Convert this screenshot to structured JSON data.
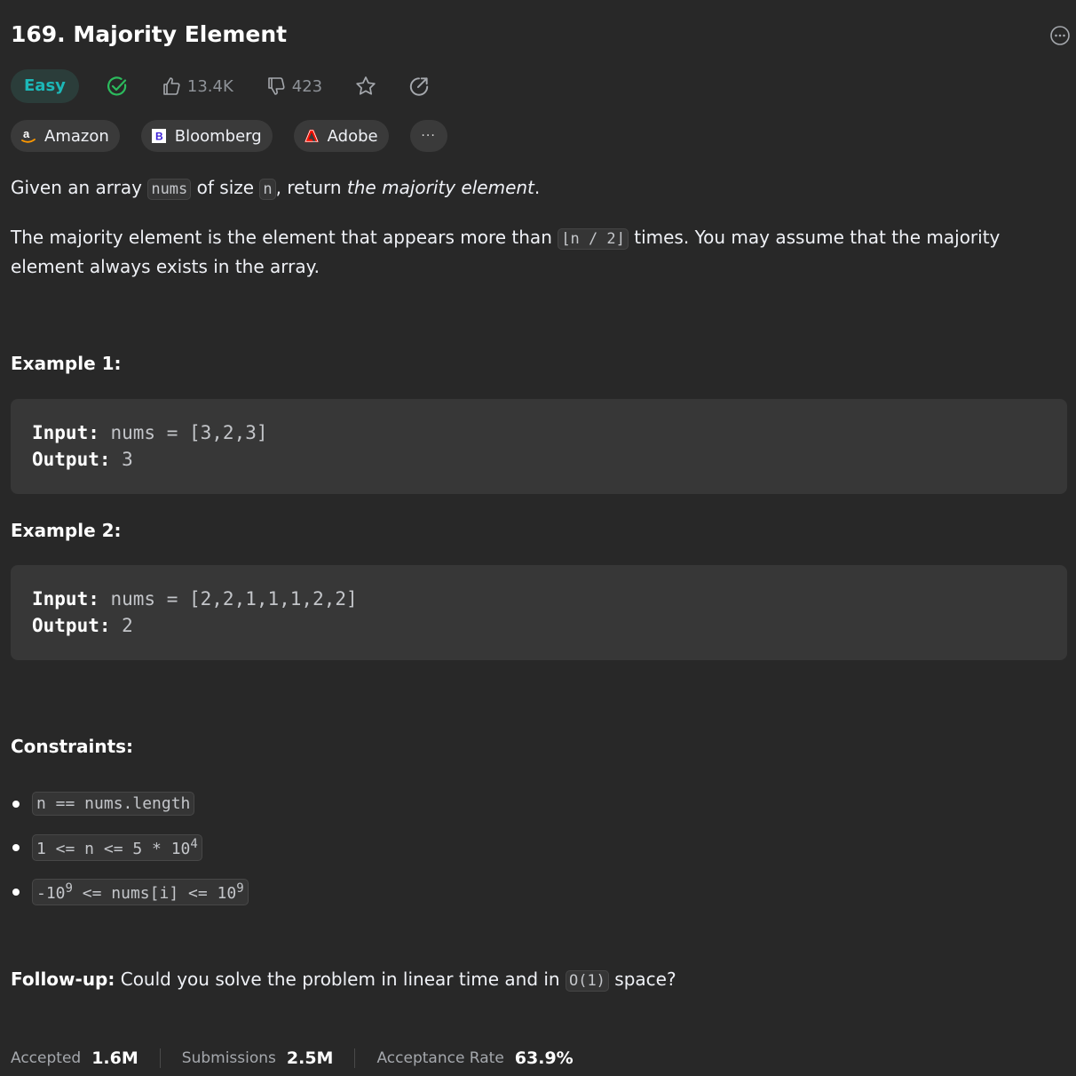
{
  "problem": {
    "title": "169. Majority Element",
    "difficulty": "Easy",
    "likes": "13.4K",
    "dislikes": "423"
  },
  "tags": [
    {
      "label": "Amazon"
    },
    {
      "label": "Bloomberg"
    },
    {
      "label": "Adobe"
    }
  ],
  "more_tags_label": "···",
  "description": {
    "p1_start": "Given an array ",
    "p1_code1": "nums",
    "p1_mid": " of size ",
    "p1_code2": "n",
    "p1_mid2": ", return ",
    "p1_em": "the majority element",
    "p1_end": ".",
    "p2_start": "The majority element is the element that appears more than ",
    "p2_code": "⌊n / 2⌋",
    "p2_end": " times. You may assume that the majority element always exists in the array."
  },
  "examples": [
    {
      "heading": "Example 1:",
      "input_label": "Input:",
      "input_value": " nums = [3,2,3]",
      "output_label": "Output:",
      "output_value": " 3"
    },
    {
      "heading": "Example 2:",
      "input_label": "Input:",
      "input_value": " nums = [2,2,1,1,1,2,2]",
      "output_label": "Output:",
      "output_value": " 2"
    }
  ],
  "constraints": {
    "heading": "Constraints:",
    "c1": "n == nums.length",
    "c2_text": "1 <= n <= 5 * 10",
    "c2_sup": "4",
    "c3_pre": "-10",
    "c3_sup1": "9",
    "c3_mid": " <= nums[i] <= 10",
    "c3_sup2": "9"
  },
  "followup": {
    "label": "Follow-up:",
    "text_start": " Could you solve the problem in linear time and in ",
    "code": "O(1)",
    "text_end": " space?"
  },
  "stats": {
    "accepted_label": "Accepted",
    "accepted_value": "1.6M",
    "submissions_label": "Submissions",
    "submissions_value": "2.5M",
    "rate_label": "Acceptance Rate",
    "rate_value": "63.9%"
  },
  "colors": {
    "background": "#282828",
    "easy": "#1cb8b8",
    "solved_check": "#2cbb5d"
  }
}
